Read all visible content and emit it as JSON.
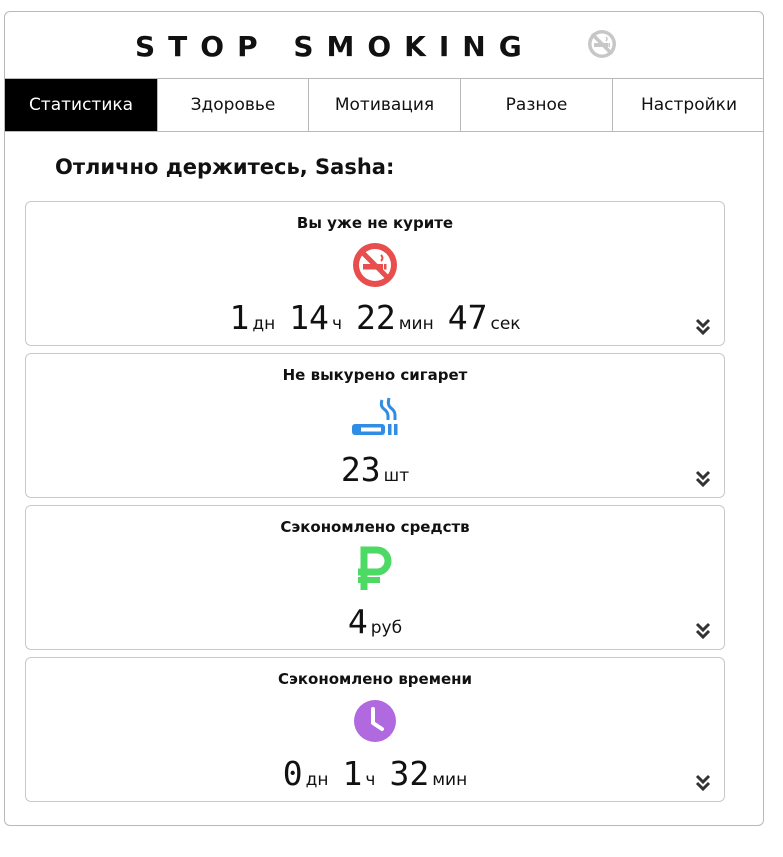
{
  "header": {
    "title": "STOP SMOKING",
    "icon": "no-smoking-icon"
  },
  "tabs": [
    {
      "label": "Статистика",
      "active": true
    },
    {
      "label": "Здоровье",
      "active": false
    },
    {
      "label": "Мотивация",
      "active": false
    },
    {
      "label": "Разное",
      "active": false
    },
    {
      "label": "Настройки",
      "active": false
    }
  ],
  "greeting": "Отлично держитесь, Sasha:",
  "cards": {
    "smoke_free": {
      "title": "Вы уже не курите",
      "icon": "no-smoking-icon",
      "color": "#e94e4e",
      "values": [
        {
          "num": "1",
          "unit": "дн"
        },
        {
          "num": "14",
          "unit": "ч"
        },
        {
          "num": "22",
          "unit": "мин"
        },
        {
          "num": "47",
          "unit": "сек"
        }
      ]
    },
    "cigarettes": {
      "title": "Не выкурено сигарет",
      "icon": "cigarette-icon",
      "color": "#2f8de4",
      "values": [
        {
          "num": "23",
          "unit": "шт"
        }
      ]
    },
    "money": {
      "title": "Сэкономлено средств",
      "icon": "ruble-icon",
      "color": "#4cd964",
      "values": [
        {
          "num": "4",
          "unit": "руб"
        }
      ]
    },
    "time": {
      "title": "Сэкономлено времени",
      "icon": "clock-icon",
      "color": "#b169e0",
      "values": [
        {
          "num": "0",
          "unit": "дн"
        },
        {
          "num": "1",
          "unit": "ч"
        },
        {
          "num": "32",
          "unit": "мин"
        }
      ]
    }
  },
  "expand_icon": "chevron-double-down-icon"
}
